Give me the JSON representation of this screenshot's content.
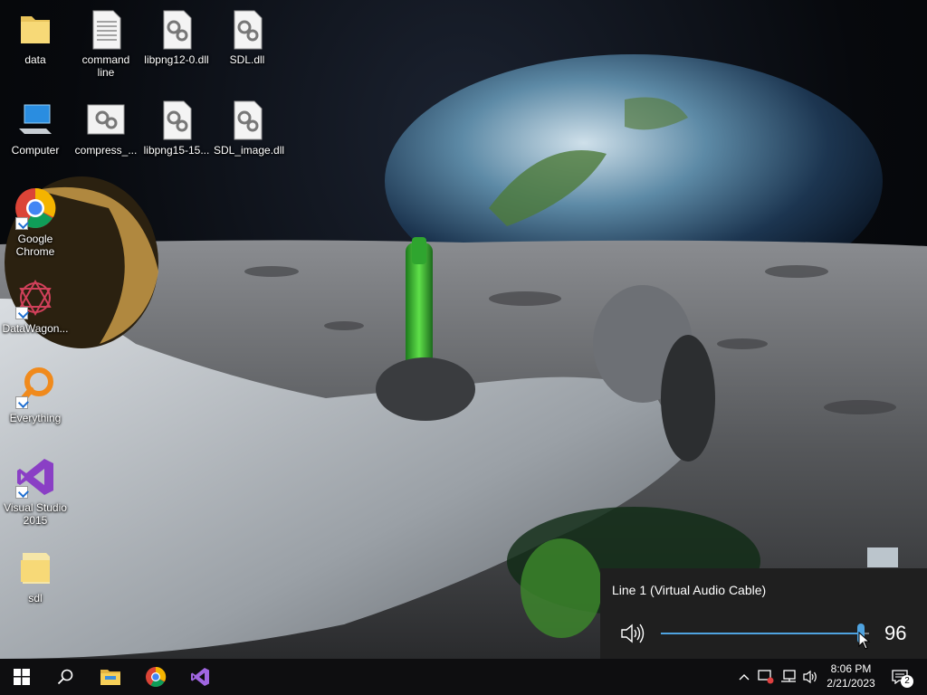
{
  "desktop": {
    "icons": [
      {
        "label": "data",
        "icon": "folder-icon"
      },
      {
        "label": "command line",
        "icon": "text-file-icon"
      },
      {
        "label": "libpng12-0.dll",
        "icon": "dll-file-icon"
      },
      {
        "label": "SDL.dll",
        "icon": "dll-file-icon"
      },
      {
        "label": "Computer",
        "icon": "computer-icon"
      },
      {
        "label": "compress_...",
        "icon": "settings-file-icon"
      },
      {
        "label": "libpng15-15...",
        "icon": "dll-file-icon"
      },
      {
        "label": "SDL_image.dll",
        "icon": "dll-file-icon"
      },
      {
        "label": "Google Chrome",
        "icon": "chrome-icon"
      },
      {
        "label": "DataWagon...",
        "icon": "datawagon-icon"
      },
      {
        "label": "Everything",
        "icon": "everything-search-icon"
      },
      {
        "label": "Visual Studio 2015",
        "icon": "visual-studio-icon"
      },
      {
        "label": "sdl",
        "icon": "folder-icon"
      }
    ]
  },
  "volume_flyout": {
    "device": "Line 1 (Virtual Audio Cable)",
    "level": 96,
    "level_text": "96",
    "accent": "#4fa3e0"
  },
  "taskbar": {
    "pinned": [
      "windows-start-icon",
      "search-icon",
      "file-explorer-icon",
      "chrome-icon",
      "visual-studio-icon"
    ],
    "tray": [
      "chevron-up-icon",
      "network-warning-icon",
      "network-icon",
      "speaker-icon"
    ],
    "clock": {
      "time": "8:06 PM",
      "date": "2/21/2023"
    },
    "notifications": {
      "count": "2"
    }
  },
  "colors": {
    "taskbar": "#0e0e10",
    "flyout": "#1f1f1f"
  }
}
